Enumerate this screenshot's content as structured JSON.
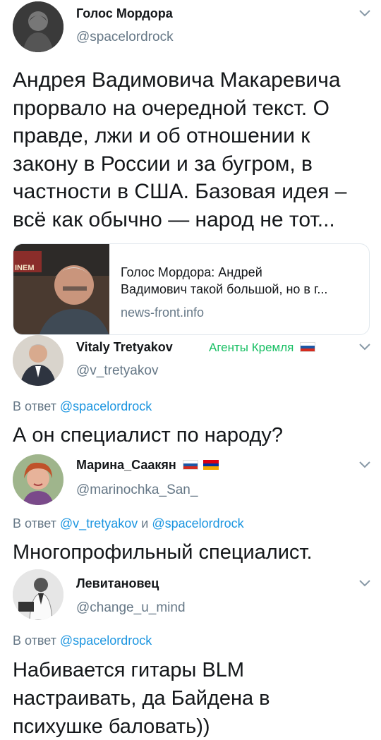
{
  "tweets": [
    {
      "name": "Голос Мордора",
      "handle": "@spacelordrock",
      "text_lines": [
        "Андрея Вадимовича Макаревича",
        "прорвало на очередной текст. О",
        "правде, лжи и об отношении к",
        "закону в России и за бугром, в",
        "частности в США. Базовая идея –",
        "всё как обычно — народ не тот..."
      ],
      "card": {
        "image_caption": "ІNEM",
        "title_line1": "Голос Мордора: Андрей",
        "title_line2": "Вадимович такой большой, но в г...",
        "domain": "news-front.info"
      }
    },
    {
      "name": "Vitaly Tretyakov",
      "handle": "@v_tretyakov",
      "badge": "Агенты Кремля",
      "reply_prefix": "В ответ",
      "reply_to": "@spacelordrock",
      "text": "А он специалист по народу?"
    },
    {
      "name": "Марина_Саакян",
      "handle": "@marinochka_San_",
      "reply_prefix": "В ответ",
      "reply_to": "@v_tretyakov",
      "reply_and": "и",
      "reply_to2": "@spacelordrock",
      "text": "Многопрофильный специалист."
    },
    {
      "name": "Левитановец",
      "handle": "@change_u_mind",
      "reply_prefix": "В ответ",
      "reply_to": "@spacelordrock",
      "text_lines": [
        "Набивается гитары BLM",
        "настраивать, да Байдена в",
        "психушке баловать))"
      ]
    }
  ],
  "colors": {
    "link": "#1b95e0",
    "secondary": "#657786",
    "badge": "#17bf63",
    "flag_ru": [
      "#ffffff",
      "#1c57a5",
      "#d52b1e"
    ],
    "flag_am": [
      "#d90012",
      "#0033a0",
      "#f2a800"
    ]
  },
  "icons": [
    "chevron-down-icon",
    "flag-ru-icon",
    "flag-am-icon"
  ]
}
